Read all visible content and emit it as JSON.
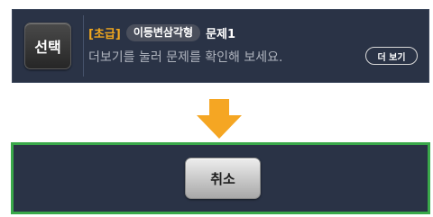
{
  "problem_card": {
    "select_label": "선택",
    "level": "[초급]",
    "topic": "이등변삼각형",
    "problem_name": "문제1",
    "hint": "더보기를 눌러 문제를 확인해 보세요.",
    "more_label": "더 보기"
  },
  "arrow": {
    "icon": "down-arrow-icon",
    "color": "#f5a623"
  },
  "cancel_panel": {
    "cancel_label": "취소",
    "highlight_color": "#3aa84a"
  }
}
